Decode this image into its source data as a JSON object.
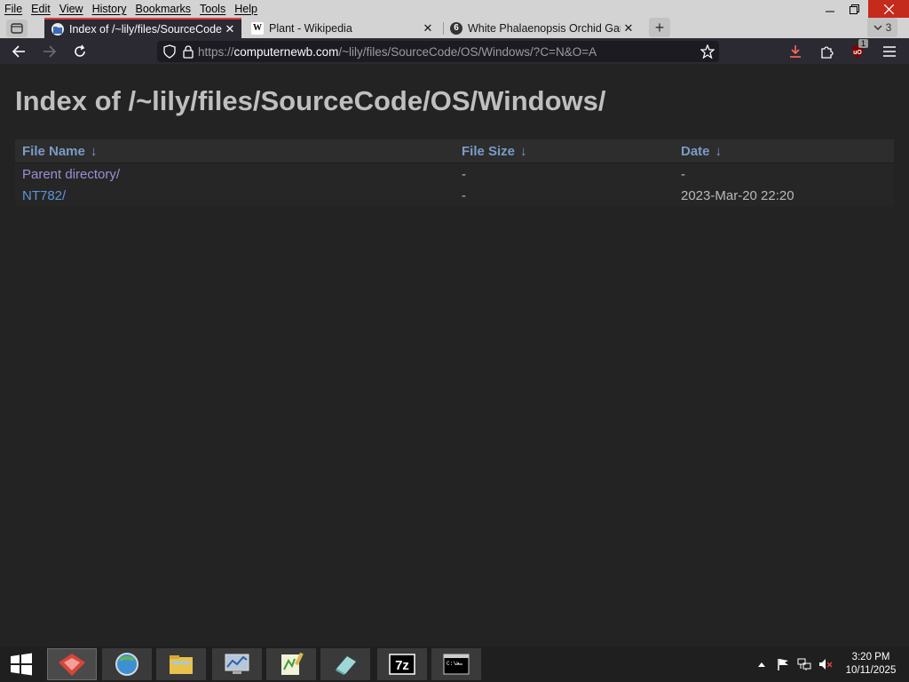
{
  "menubar": {
    "items": [
      "File",
      "Edit",
      "View",
      "History",
      "Bookmarks",
      "Tools",
      "Help"
    ]
  },
  "tabs": [
    {
      "title": "Index of /~lily/files/SourceCode",
      "favicon": "folder-icon",
      "active": true
    },
    {
      "title": "Plant - Wikipedia",
      "favicon": "wikipedia-icon",
      "active": false
    },
    {
      "title": "White Phalaenopsis Orchid Garc",
      "favicon": "site-icon",
      "active": false
    }
  ],
  "tab_count": "3",
  "navbar": {
    "url_host": "computernewb.com",
    "url_scheme": "https://",
    "url_path": "/~lily/files/SourceCode/OS/Windows/?C=N&O=A",
    "extension_badge": "1"
  },
  "page": {
    "title": "Index of /~lily/files/SourceCode/OS/Windows/",
    "columns": [
      "File Name",
      "File Size",
      "Date"
    ],
    "sort_arrow": "↓",
    "rows": [
      {
        "name": "Parent directory/",
        "size": "-",
        "date": "-"
      },
      {
        "name": "NT782/",
        "size": "-",
        "date": "2023-Mar-20 22:20"
      }
    ]
  },
  "taskbar": {
    "time": "3:20 PM",
    "date": "10/11/2025"
  },
  "colors": {
    "tab_accent": "#e03a3a",
    "link": "#5e95d6",
    "visited_link": "#9b8fd6",
    "taskbar": "#1f1f1f"
  }
}
